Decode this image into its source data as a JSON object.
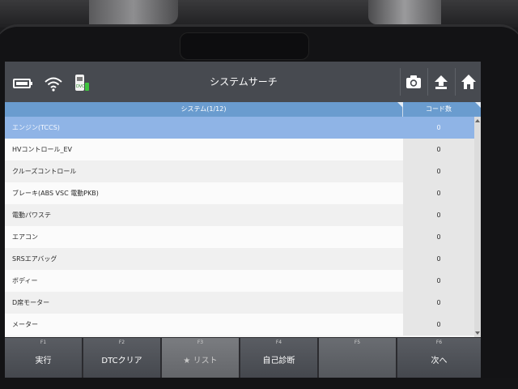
{
  "header": {
    "title": "システムサーチ"
  },
  "icons": {
    "battery": "battery-icon",
    "wifi": "wifi-icon",
    "vci": "vci-device-icon",
    "camera": "camera-icon",
    "upload": "upload-icon",
    "home": "home-icon"
  },
  "table": {
    "col_system": "システム(1/12)",
    "col_code": "コード数",
    "rows": [
      {
        "name": "エンジン(TCCS)",
        "code": "0"
      },
      {
        "name": "HVコントロール_EV",
        "code": "0"
      },
      {
        "name": "クルーズコントロール",
        "code": "0"
      },
      {
        "name": "ブレーキ(ABS VSC 電動PKB)",
        "code": "0"
      },
      {
        "name": "電動パワステ",
        "code": "0"
      },
      {
        "name": "エアコン",
        "code": "0"
      },
      {
        "name": "SRSエアバッグ",
        "code": "0"
      },
      {
        "name": "ボディー",
        "code": "0"
      },
      {
        "name": "D席モーター",
        "code": "0"
      },
      {
        "name": "メーター",
        "code": "0"
      }
    ]
  },
  "fkeys": [
    {
      "num": "F1",
      "label": "実行"
    },
    {
      "num": "F2",
      "label": "DTCクリア"
    },
    {
      "num": "F3",
      "label": "★ リスト"
    },
    {
      "num": "F4",
      "label": "自己診断"
    },
    {
      "num": "F5",
      "label": ""
    },
    {
      "num": "F6",
      "label": "次へ"
    }
  ],
  "colors": {
    "header_bg": "#474a50",
    "table_head_bg": "#6a9ccf",
    "selected_row": "#8fb4e6",
    "fkey_bg": "#4f5258"
  }
}
